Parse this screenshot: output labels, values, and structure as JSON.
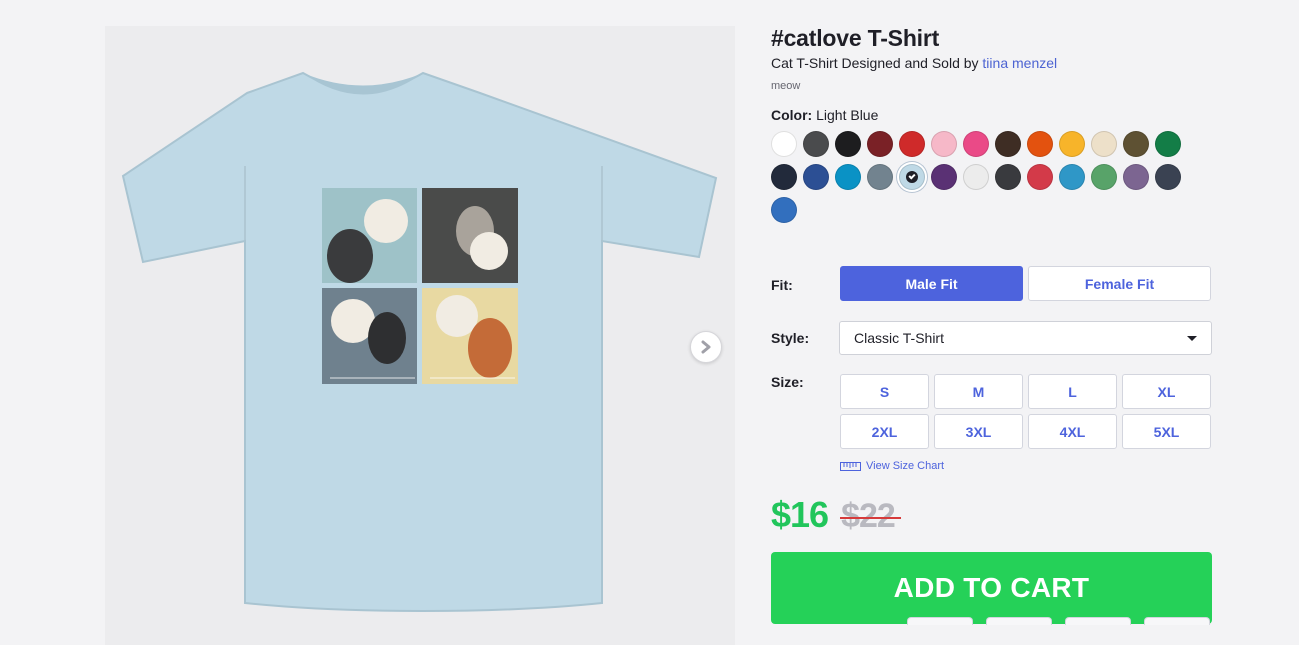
{
  "product": {
    "title": "#catlove T-Shirt",
    "byline_prefix": "Cat T-Shirt Designed and Sold by",
    "artist": "tiina menzel",
    "tag": "meow"
  },
  "color": {
    "label": "Color:",
    "selected": "Light Blue",
    "swatches": [
      {
        "name": "White",
        "hex": "#ffffff"
      },
      {
        "name": "Charcoal",
        "hex": "#4a4b4d"
      },
      {
        "name": "Black",
        "hex": "#1d1d1f"
      },
      {
        "name": "Maroon",
        "hex": "#7a2126"
      },
      {
        "name": "Red",
        "hex": "#cf2a2a"
      },
      {
        "name": "Pink",
        "hex": "#f6b8c8"
      },
      {
        "name": "Hot Pink",
        "hex": "#ea4a87"
      },
      {
        "name": "Brown",
        "hex": "#3e2d24"
      },
      {
        "name": "Orange",
        "hex": "#e3520f"
      },
      {
        "name": "Gold",
        "hex": "#f7b42a"
      },
      {
        "name": "Natural",
        "hex": "#ede0c9"
      },
      {
        "name": "Olive",
        "hex": "#5e5133"
      },
      {
        "name": "Kelly Green",
        "hex": "#137d47"
      },
      {
        "name": "Navy",
        "hex": "#222a3b"
      },
      {
        "name": "Royal Blue",
        "hex": "#2c4f94"
      },
      {
        "name": "Turquoise",
        "hex": "#0a92c5"
      },
      {
        "name": "Slate",
        "hex": "#72838f"
      },
      {
        "name": "Light Blue",
        "hex": "#bfd9e6",
        "selected": true
      },
      {
        "name": "Purple",
        "hex": "#5a3174"
      },
      {
        "name": "Heather White",
        "hex": "#ececec"
      },
      {
        "name": "Heather Charcoal",
        "hex": "#393a3e"
      },
      {
        "name": "Heather Red",
        "hex": "#d33a49"
      },
      {
        "name": "Heather Turquoise",
        "hex": "#2f97c7"
      },
      {
        "name": "Heather Green",
        "hex": "#58a369"
      },
      {
        "name": "Heather Purple",
        "hex": "#7c6591"
      },
      {
        "name": "Heather Navy",
        "hex": "#3a4252"
      },
      {
        "name": "Heather Royal",
        "hex": "#326fbe"
      }
    ]
  },
  "fit": {
    "label": "Fit:",
    "male": "Male Fit",
    "female": "Female Fit"
  },
  "style": {
    "label": "Style:",
    "selected": "Classic T-Shirt"
  },
  "size": {
    "label": "Size:",
    "options": [
      "S",
      "M",
      "L",
      "XL",
      "2XL",
      "3XL",
      "4XL",
      "5XL"
    ],
    "chart_link": "View Size Chart"
  },
  "price": {
    "current": "$16",
    "original": "$22"
  },
  "cart": {
    "label": "ADD TO CART"
  },
  "colors": {
    "accent": "#4d63dd",
    "cta": "#25d158",
    "shirt": "#bfd9e6"
  }
}
